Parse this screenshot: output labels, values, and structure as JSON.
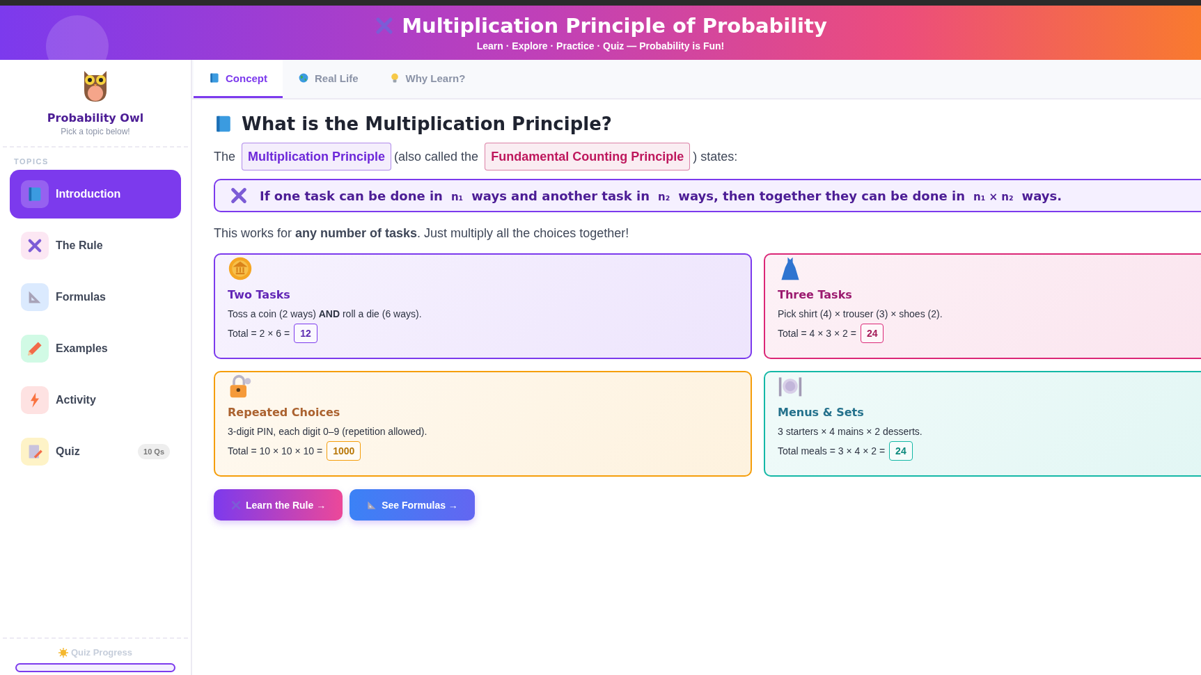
{
  "header": {
    "title": "Multiplication Principle of Probability",
    "subtitle": "Learn · Explore · Practice · Quiz — Probability is Fun!"
  },
  "sidebar": {
    "brand": "Probability Owl",
    "tagline": "Pick a topic below!",
    "section": "TOPICS",
    "items": [
      {
        "label": "Introduction",
        "selected": true
      },
      {
        "label": "The Rule",
        "selected": false
      },
      {
        "label": "Formulas",
        "selected": false
      },
      {
        "label": "Examples",
        "selected": false
      },
      {
        "label": "Activity",
        "selected": false
      },
      {
        "label": "Quiz",
        "selected": false,
        "badge": "10 Qs"
      }
    ],
    "progress": {
      "label": "Quiz Progress",
      "level": 0
    }
  },
  "tabs": [
    {
      "label": "Concept",
      "selected": true
    },
    {
      "label": "Real Life",
      "selected": false
    },
    {
      "label": "Why Learn?",
      "selected": false
    }
  ],
  "heading": "What is the Multiplication Principle?",
  "intro": [
    {
      "kind": "text",
      "text": "The"
    },
    {
      "kind": "term",
      "text": "Multiplication Principle",
      "color": "#6d28d9"
    },
    {
      "kind": "text",
      "text": "(also called the"
    },
    {
      "kind": "term",
      "text": "Fundamental Counting Principle",
      "color": "#be185d"
    },
    {
      "kind": "text",
      "text": ") states:"
    }
  ],
  "rule": [
    {
      "kind": "text",
      "text": "If one task can be done in"
    },
    {
      "kind": "var",
      "text": "n₁"
    },
    {
      "kind": "text",
      "text": "ways and another task in"
    },
    {
      "kind": "var",
      "text": "n₂"
    },
    {
      "kind": "text",
      "text": "ways, then together they can be done in"
    },
    {
      "kind": "var",
      "text": "n₁ × n₂"
    },
    {
      "kind": "text",
      "text": "ways."
    }
  ],
  "note": "This works for **any number of tasks**. Just multiply all the choices together!",
  "cards": [
    {
      "title": "Two Tasks",
      "color": "#7c3aed",
      "text": "Toss a coin (2 ways) **AND** roll a die (6 ways).",
      "total": "Total = 2 × 6 =",
      "answer": "12"
    },
    {
      "title": "Three Tasks",
      "color": "#db2777",
      "text": "Pick shirt (4) × trouser (3) × shoes (2).",
      "total": "Total = 4 × 3 × 2 =",
      "answer": "24"
    },
    {
      "title": "Repeated Choices",
      "color": "#f59e0b",
      "text": "3-digit PIN, each digit 0–9 (repetition allowed).",
      "total": "Total = 10 × 10 × 10 =",
      "answer": "1000"
    },
    {
      "title": "Menus & Sets",
      "color": "#14b8a6",
      "text": "3 starters × 4 mains × 2 desserts.",
      "total": "Total meals = 3 × 4 × 2 =",
      "answer": "24"
    }
  ],
  "buttons": [
    {
      "label": "Learn the Rule →",
      "kind": "primary"
    },
    {
      "label": "See Formulas →",
      "kind": "secondary"
    }
  ]
}
